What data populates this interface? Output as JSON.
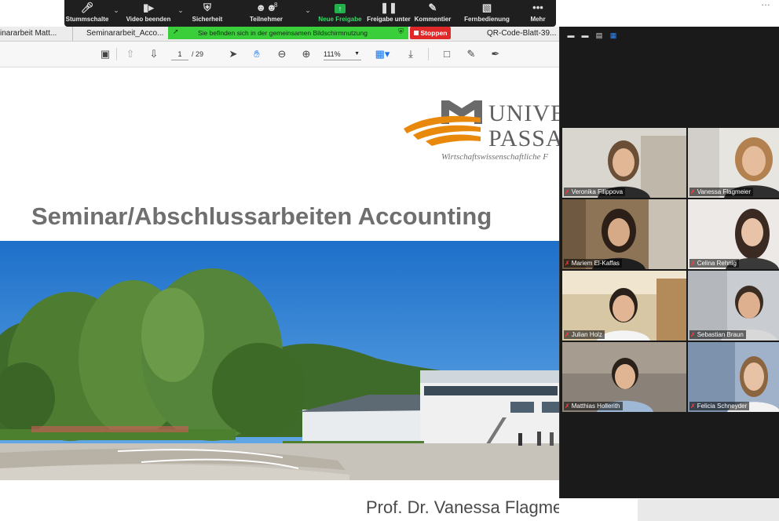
{
  "zoom_toolbar": {
    "mute_label": "Stummschalte",
    "video_label": "Video beenden",
    "security_label": "Sicherheit",
    "participants_label": "Teilnehmer",
    "participants_count": "8",
    "new_share_label": "Neue Freigabe",
    "pause_share_label": "Freigabe unter",
    "annotate_label": "Kommentier",
    "remote_control_label": "Fernbedienung",
    "more_label": "Mehr"
  },
  "sharing_banner": {
    "text": "Sie befinden sich in der gemeinsamen Bildschirmnutzung",
    "stop_label": "Stoppen"
  },
  "tabs": [
    {
      "label": "inararbeit Matt..."
    },
    {
      "label": "Seminararbeit_Acco..."
    },
    {
      "label": "QR-Code-Blatt-39..."
    }
  ],
  "pdf_toolbar": {
    "page_current": "1",
    "page_total": "/ 29",
    "zoom": "111%"
  },
  "document": {
    "logo_line1": "UNIVER",
    "logo_line2": "PASSAU",
    "logo_subtitle": "Wirtschaftswissenschaftliche F",
    "title": "Seminar/Abschlussarbeiten Accounting",
    "author": "Prof. Dr. Vanessa Flagmeier"
  },
  "participants": [
    {
      "name": "Veronika Filippova"
    },
    {
      "name": "Vanessa Flagmeier"
    },
    {
      "name": "Mariem El-Kaffas"
    },
    {
      "name": "Celina Rehnig"
    },
    {
      "name": "Julian Holz"
    },
    {
      "name": "Sebastian Braun"
    },
    {
      "name": "Matthias Hollerith"
    },
    {
      "name": "Felicia Schneyder"
    }
  ],
  "colors": {
    "share_green": "#3bce3b",
    "stop_red": "#e02828",
    "active_speaker": "#e8e047",
    "logo_orange": "#e8890c"
  }
}
